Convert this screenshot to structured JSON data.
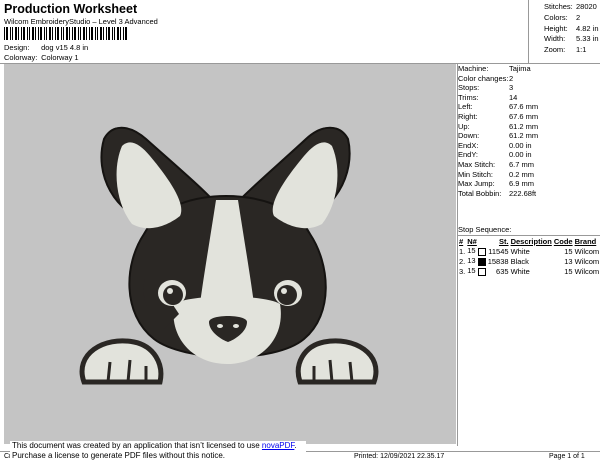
{
  "header": {
    "title": "Production Worksheet",
    "subtitle": "Wilcom EmbroideryStudio – Level 3 Advanced",
    "design_label": "Design:",
    "design_value": "dog v15 4.8 in",
    "colorway_label": "Colorway:",
    "colorway_value": "Colorway 1"
  },
  "summary": [
    {
      "label": "Stitches:",
      "value": "28020"
    },
    {
      "label": "Colors:",
      "value": "2"
    },
    {
      "label": "Height:",
      "value": "4.82 in"
    },
    {
      "label": "Width:",
      "value": "5.33 in"
    },
    {
      "label": "Zoom:",
      "value": "1:1"
    }
  ],
  "machine": [
    {
      "label": "Machine:",
      "value": "Tajima"
    },
    {
      "label": "Color changes:",
      "value": "2"
    },
    {
      "label": "Stops:",
      "value": "3"
    },
    {
      "label": "Trims:",
      "value": "14"
    },
    {
      "label": "Left:",
      "value": "67.6 mm"
    },
    {
      "label": "Right:",
      "value": "67.6 mm"
    },
    {
      "label": "Up:",
      "value": "61.2 mm"
    },
    {
      "label": "Down:",
      "value": "61.2 mm"
    },
    {
      "label": "EndX:",
      "value": "0.00 in"
    },
    {
      "label": "EndY:",
      "value": "0.00 in"
    },
    {
      "label": "Max Stitch:",
      "value": "6.7 mm"
    },
    {
      "label": "Min Stitch:",
      "value": "0.2 mm"
    },
    {
      "label": "Max Jump:",
      "value": "6.9 mm"
    },
    {
      "label": "Total Bobbin:",
      "value": "222.68ft"
    }
  ],
  "stop_sequence": {
    "title": "Stop Sequence:",
    "headers": [
      "#",
      "N#",
      "St.",
      "Description",
      "Code",
      "Brand"
    ],
    "rows": [
      {
        "num": "1.",
        "n": "15",
        "swatch": "#ffffff",
        "st": "11545",
        "desc": "White",
        "code": "15",
        "brand": "Wilcom"
      },
      {
        "num": "2.",
        "n": "13",
        "swatch": "#000000",
        "st": "15838",
        "desc": "Black",
        "code": "13",
        "brand": "Wilcom"
      },
      {
        "num": "3.",
        "n": "15",
        "swatch": "#ffffff",
        "st": "635",
        "desc": "White",
        "code": "15",
        "brand": "Wilcom"
      }
    ]
  },
  "notice": {
    "line1": "This document was created by an application that isn’t licensed to use ",
    "link": "novaPDF",
    "line1_end": ".",
    "line2": "Purchase a license to generate PDF files without this notice."
  },
  "footer": {
    "left": "Cr",
    "printed": "Printed: 12/09/2021 22.35.17",
    "page": "Page 1 of 1"
  },
  "colors": {
    "background": "#c4c4c4",
    "dark_thread": "#2a2724",
    "light_thread": "#e2e3dc"
  }
}
